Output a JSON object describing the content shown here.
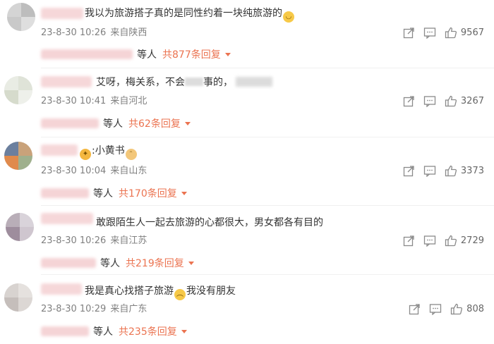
{
  "comments": [
    {
      "text": "我以为旅游搭子真的是同性约着一块纯旅游的",
      "emoji": "blink-emoji",
      "date": "23-8-30 10:26",
      "location": "来自陕西",
      "likes": "9567",
      "reply_suffix": "等人",
      "reply_link": "共877条回复"
    },
    {
      "text_a": "艾呀，梅关系，不会",
      "text_b": "事的，",
      "date": "23-8-30 10:41",
      "location": "来自河北",
      "likes": "3267",
      "reply_suffix": "等人",
      "reply_link": "共62条回复"
    },
    {
      "text": ":小黄书",
      "date": "23-8-30 10:04",
      "location": "来自山东",
      "likes": "3373",
      "reply_suffix": "等人",
      "reply_link": "共170条回复"
    },
    {
      "text": "敢跟陌生人一起去旅游的心都很大，男女都各有目的",
      "date": "23-8-30 10:26",
      "location": "来自江苏",
      "likes": "2729",
      "reply_suffix": "等人",
      "reply_link": "共219条回复"
    },
    {
      "text_a": "我是真心找搭子旅游",
      "text_b": "我没有朋友",
      "date": "23-8-30 10:29",
      "location": "来自广东",
      "likes": "808",
      "reply_suffix": "等人",
      "reply_link": "共235条回复"
    }
  ],
  "icons": {
    "share": "share-icon",
    "comment": "comment-icon",
    "like": "thumbs-up-icon",
    "expand": "caret-down-icon"
  },
  "colors": {
    "link": "#eb7350",
    "meta": "#808080",
    "text": "#333333"
  }
}
